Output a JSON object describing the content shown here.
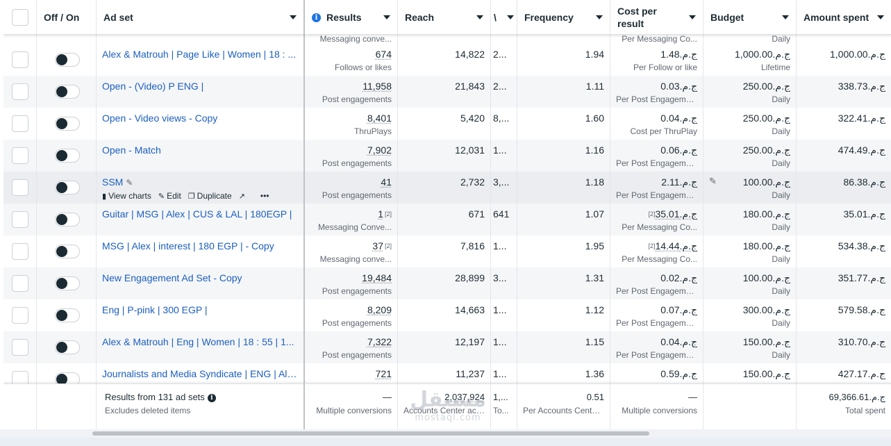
{
  "columns": {
    "toggle": "Off / On",
    "ad_set": "Ad set",
    "results": "Results",
    "reach": "Reach",
    "impressions": "\\",
    "frequency": "Frequency",
    "cost_per_result": "Cost per result",
    "budget": "Budget",
    "amount_spent": "Amount spent"
  },
  "partial_row": {
    "results_sub": "Messaging conve...",
    "cost_sub": "Per Messaging Co...",
    "budget_sub": "Daily"
  },
  "rows": [
    {
      "name": "Alex & Matrouh | Page Like | Women | 18 : ...",
      "results": "674",
      "results_sub": "Follows or likes",
      "results_note": "",
      "reach": "14,822",
      "impressions": "2...",
      "frequency": "1.94",
      "cost": "ج.م.1.48",
      "cost_note": "",
      "cost_sub": "Per Follow or like",
      "budget": "ج.م.1,000.00",
      "budget_sub": "Lifetime",
      "spent": "ج.م.1,000.00"
    },
    {
      "name": "Open - (Video) P ENG |",
      "results": "11,958",
      "results_sub": "Post engagements",
      "results_note": "",
      "reach": "21,843",
      "impressions": "2...",
      "frequency": "1.11",
      "cost": "ج.م.0.03",
      "cost_note": "",
      "cost_sub": "Per Post Engagement",
      "budget": "ج.م.250.00",
      "budget_sub": "Daily",
      "spent": "ج.م.338.73"
    },
    {
      "name": "Open - Video views - Copy",
      "results": "8,401",
      "results_sub": "ThruPlays",
      "results_note": "",
      "reach": "5,420",
      "impressions": "8,...",
      "frequency": "1.60",
      "cost": "ج.م.0.04",
      "cost_note": "",
      "cost_sub": "Cost per ThruPlay",
      "budget": "ج.م.250.00",
      "budget_sub": "Daily",
      "spent": "ج.م.322.41"
    },
    {
      "name": "Open - Match",
      "results": "7,902",
      "results_sub": "Post engagements",
      "results_note": "",
      "reach": "12,031",
      "impressions": "1...",
      "frequency": "1.16",
      "cost": "ج.م.0.06",
      "cost_note": "",
      "cost_sub": "Per Post Engagement",
      "budget": "ج.م.250.00",
      "budget_sub": "Daily",
      "spent": "ج.م.474.49"
    },
    {
      "name": "SSM",
      "results": "41",
      "results_sub": "Post engagements",
      "results_note": "",
      "reach": "2,732",
      "impressions": "3,...",
      "frequency": "1.18",
      "cost": "ج.م.2.11",
      "cost_note": "",
      "cost_sub": "Per Post Engagement",
      "budget": "ج.م.100.00",
      "budget_sub": "Daily",
      "spent": "ج.م.86.38",
      "hover_actions": {
        "view_charts": "View charts",
        "edit": "Edit",
        "duplicate": "Duplicate",
        "more": "•••"
      }
    },
    {
      "name": "Guitar | MSG | Alex | CUS & LAL | 180EGP |",
      "results": "1",
      "results_sub": "Messaging Conve...",
      "results_note": "[2]",
      "reach": "671",
      "impressions": "641",
      "frequency": "1.07",
      "cost": "ج.م.35.01",
      "cost_note": "[2]",
      "cost_sub": "Per Messaging Co...",
      "budget": "ج.م.180.00",
      "budget_sub": "Daily",
      "spent": "ج.م.35.01"
    },
    {
      "name": "MSG | Alex | interest | 180 EGP | - Copy",
      "results": "37",
      "results_sub": "Messaging conve...",
      "results_note": "[2]",
      "reach": "7,816",
      "impressions": "1...",
      "frequency": "1.95",
      "cost": "ج.م.14.44",
      "cost_note": "[2]",
      "cost_sub": "Per Messaging Co...",
      "budget": "ج.م.180.00",
      "budget_sub": "Daily",
      "spent": "ج.م.534.38"
    },
    {
      "name": "New Engagement Ad Set - Copy",
      "results": "19,484",
      "results_sub": "Post engagements",
      "results_note": "",
      "reach": "28,899",
      "impressions": "3...",
      "frequency": "1.31",
      "cost": "ج.م.0.02",
      "cost_note": "",
      "cost_sub": "Per Post Engagement",
      "budget": "ج.م.100.00",
      "budget_sub": "Daily",
      "spent": "ج.م.351.77"
    },
    {
      "name": "Eng | P-pink | 300 EGP |",
      "results": "8,209",
      "results_sub": "Post engagements",
      "results_note": "",
      "reach": "14,663",
      "impressions": "1...",
      "frequency": "1.12",
      "cost": "ج.م.0.07",
      "cost_note": "",
      "cost_sub": "Per Post Engagement",
      "budget": "ج.م.300.00",
      "budget_sub": "Daily",
      "spent": "ج.م.579.58"
    },
    {
      "name": "Alex & Matrouh | Eng | Women | 18 : 55 | 1...",
      "results": "7,322",
      "results_sub": "Post engagements",
      "results_note": "",
      "reach": "12,197",
      "impressions": "1...",
      "frequency": "1.15",
      "cost": "ج.م.0.04",
      "cost_note": "",
      "cost_sub": "Per Post Engagement",
      "budget": "ج.م.150.00",
      "budget_sub": "Daily",
      "spent": "ج.م.310.70"
    },
    {
      "name": "Journalists and Media Syndicate | ENG | Ale...",
      "results": "721",
      "results_sub": "",
      "results_note": "",
      "reach": "11,237",
      "impressions": "1...",
      "frequency": "1.36",
      "cost": "ج.م.0.59",
      "cost_note": "",
      "cost_sub": "",
      "budget": "ج.م.150.00",
      "budget_sub": "",
      "spent": "ج.م.427.17"
    }
  ],
  "footer": {
    "title": "Results from 131 ad sets",
    "subtitle": "Excludes deleted items",
    "results": "—",
    "results_sub": "Multiple conversions",
    "reach": "2,037,924",
    "reach_sub": "Accounts Center acc...",
    "impressions": "1,...",
    "impressions_sub": "To...",
    "frequency": "0.51",
    "frequency_sub": "Per Accounts Center...",
    "cost": "—",
    "cost_sub": "Multiple conversions",
    "spent": "ج.م.69,366.61",
    "spent_sub": "Total spent"
  },
  "watermark": {
    "arabic": "مستقل",
    "latin": "mostaql.com"
  }
}
